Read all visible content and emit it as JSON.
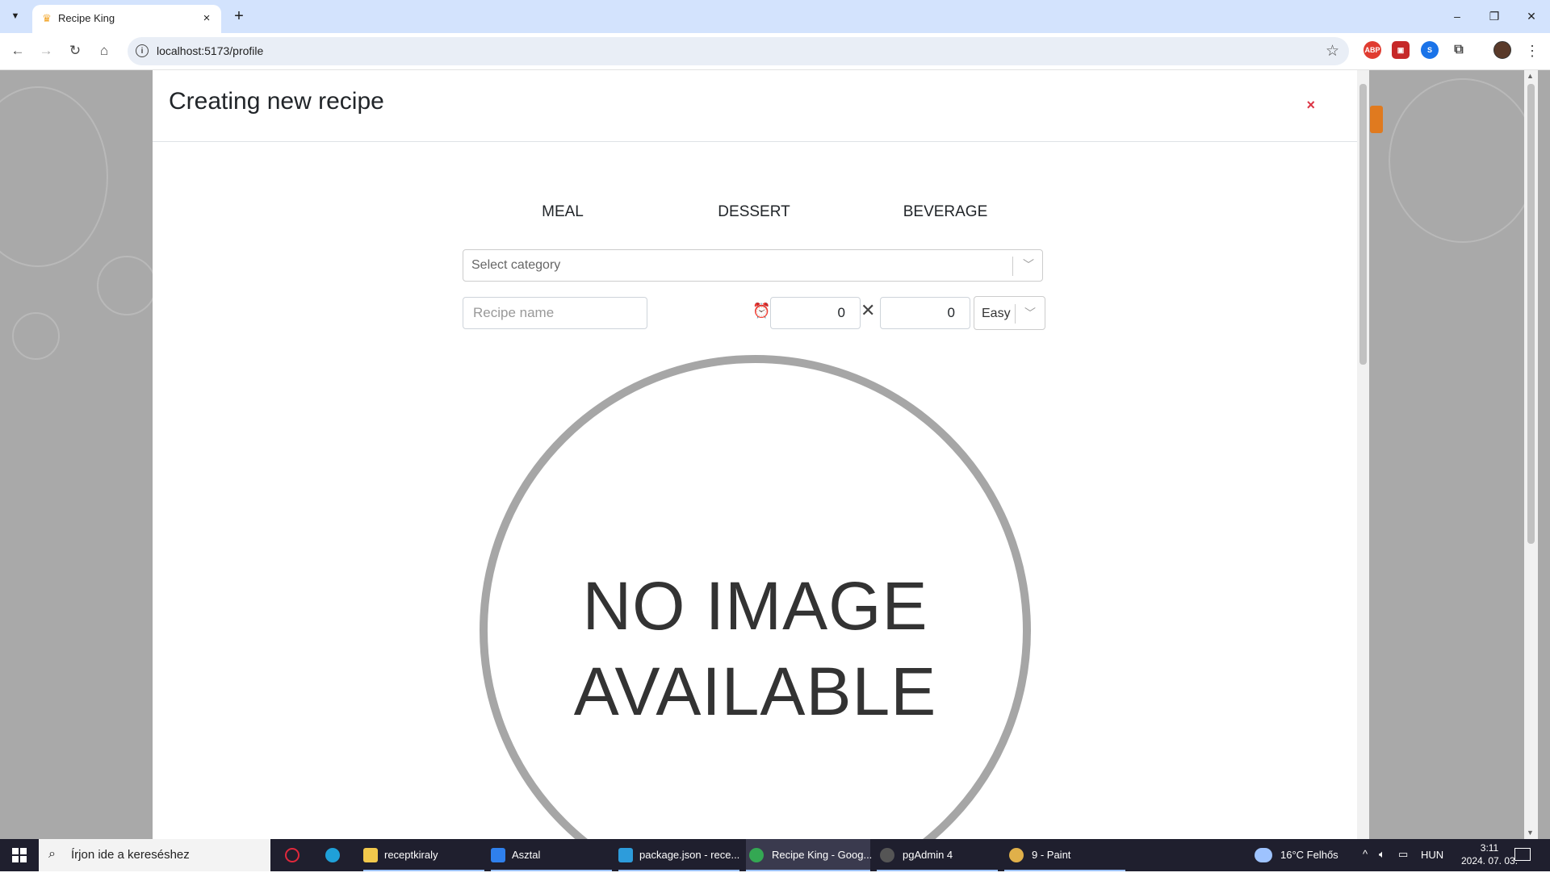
{
  "browser": {
    "tab_title": "Recipe King",
    "tab_close": "×",
    "new_tab": "+",
    "url": "localhost:5173/profile",
    "win_minimize": "–",
    "win_restore": "❐",
    "win_close": "✕",
    "ext_abp": "ABP"
  },
  "modal": {
    "title": "Creating new recipe",
    "close": "×",
    "tabs": [
      "MEAL",
      "DESSERT",
      "BEVERAGE"
    ],
    "category_placeholder": "Select category",
    "recipe_name_placeholder": "Recipe name",
    "time_value": "0",
    "servings_value": "0",
    "difficulty": "Easy",
    "no_image_line1": "NO IMAGE",
    "no_image_line2": "AVAILABLE"
  },
  "taskbar": {
    "search_placeholder": "Írjon ide a kereséshez",
    "items": [
      {
        "label": "receptkiraly",
        "color": "#f2c94c"
      },
      {
        "label": "Asztal",
        "color": "#2f80ed"
      },
      {
        "label": "package.json - rece...",
        "color": "#2d9cdb"
      },
      {
        "label": "Recipe King - Goog...",
        "color": "#34a853"
      },
      {
        "label": "pgAdmin 4",
        "color": "#555555"
      },
      {
        "label": "9 - Paint",
        "color": "#e0b04a"
      }
    ],
    "weather": "16°C  Felhős",
    "language": "HUN",
    "time": "3:11",
    "date": "2024. 07. 03."
  }
}
